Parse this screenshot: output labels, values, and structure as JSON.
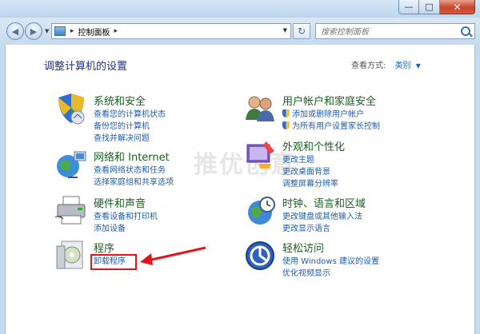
{
  "window": {
    "controls": {
      "minimize": "—",
      "maximize": "□",
      "close": "✕"
    }
  },
  "toolbar": {
    "breadcrumb": "控制面板",
    "search_placeholder": "搜索控制面板"
  },
  "header": {
    "title": "调整计算机的设置",
    "view_by_label": "查看方式:",
    "view_by_value": "类别"
  },
  "categories": [
    {
      "title": "系统和安全",
      "links": [
        "查看您的计算机状态",
        "备份您的计算机",
        "查找并解决问题"
      ],
      "icon": "shield-icon"
    },
    {
      "title": "网络和 Internet",
      "links": [
        "查看网络状态和任务",
        "选择家庭组和共享选项"
      ],
      "icon": "globe-network-icon"
    },
    {
      "title": "硬件和声音",
      "links": [
        "查看设备和打印机",
        "添加设备"
      ],
      "icon": "printer-icon"
    },
    {
      "title": "程序",
      "links": [
        "卸载程序"
      ],
      "icon": "programs-icon"
    },
    {
      "title": "用户帐户和家庭安全",
      "links": [
        "添加或删除用户帐户",
        "为所有用户设置家长控制"
      ],
      "icon": "users-icon"
    },
    {
      "title": "外观和个性化",
      "links": [
        "更改主题",
        "更改桌面背景",
        "调整屏幕分辨率"
      ],
      "icon": "paint-icon"
    },
    {
      "title": "时钟、语言和区域",
      "links": [
        "更改键盘或其他输入法",
        "更改显示语言"
      ],
      "icon": "clock-globe-icon"
    },
    {
      "title": "轻松访问",
      "links": [
        "使用 Windows 建议的设置",
        "优化视频显示"
      ],
      "icon": "ease-of-access-icon"
    }
  ],
  "watermark": "推优创意",
  "colors": {
    "link": "#1e5cab",
    "title": "#1e3287",
    "highlight": "#e3151b"
  }
}
